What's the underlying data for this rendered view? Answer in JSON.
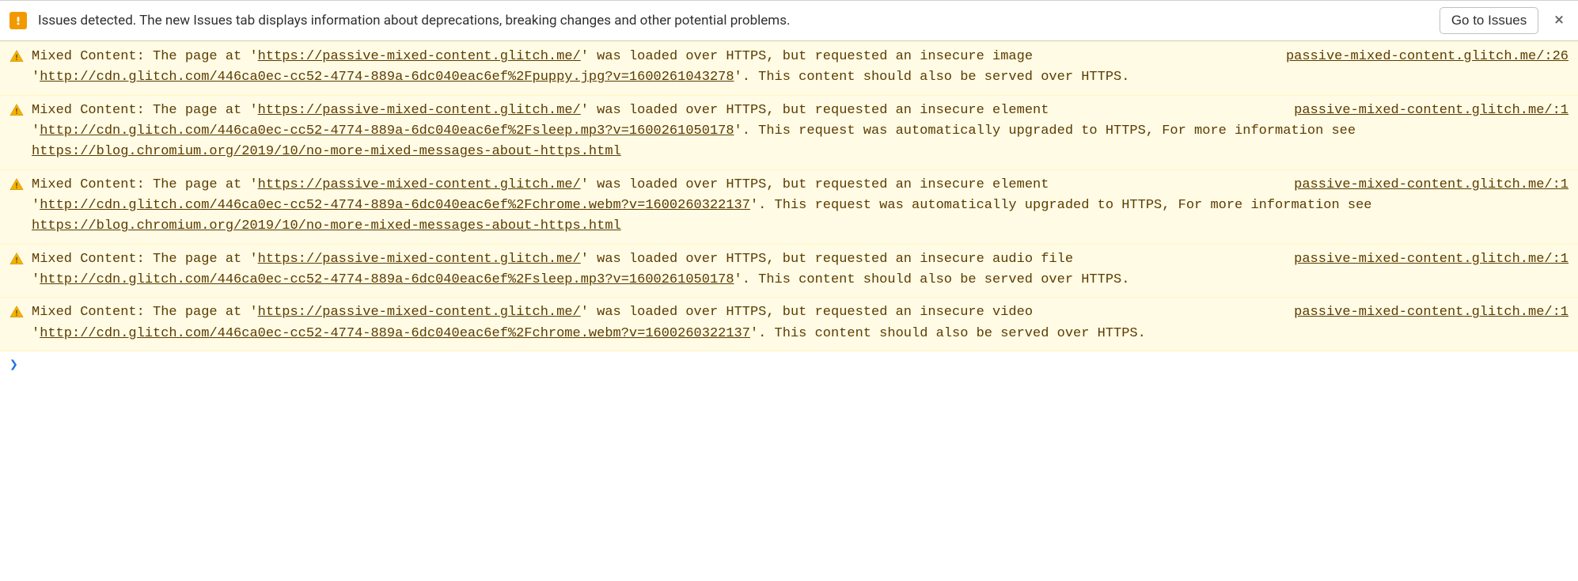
{
  "issues_bar": {
    "text": "Issues detected. The new Issues tab displays information about deprecations, breaking changes and other potential problems.",
    "button_label": "Go to Issues",
    "close_label": "×"
  },
  "messages": [
    {
      "pre1": "Mixed Content: The page at '",
      "page_url": "https://passive-mixed-content.glitch.me/",
      "mid1": "' was loaded over HTTPS, but requested an insecure image '",
      "resource_url": "http://cdn.glitch.com/446ca0ec-cc52-4774-889a-6dc040eac6ef%2Fpuppy.jpg?v=1600261043278",
      "tail": "'. This content should also be served over HTTPS.",
      "info_url": "",
      "source": "passive-mixed-content.glitch.me/:26"
    },
    {
      "pre1": "Mixed Content: The page at '",
      "page_url": "https://passive-mixed-content.glitch.me/",
      "mid1": "' was loaded over HTTPS, but requested an insecure element '",
      "resource_url": "http://cdn.glitch.com/446ca0ec-cc52-4774-889a-6dc040eac6ef%2Fsleep.mp3?v=1600261050178",
      "tail": "'. This request was automatically upgraded to HTTPS, For more information see ",
      "info_url": "https://blog.chromium.org/2019/10/no-more-mixed-messages-about-https.html",
      "source": "passive-mixed-content.glitch.me/:1"
    },
    {
      "pre1": "Mixed Content: The page at '",
      "page_url": "https://passive-mixed-content.glitch.me/",
      "mid1": "' was loaded over HTTPS, but requested an insecure element '",
      "resource_url": "http://cdn.glitch.com/446ca0ec-cc52-4774-889a-6dc040eac6ef%2Fchrome.webm?v=1600260322137",
      "tail": "'. This request was automatically upgraded to HTTPS, For more information see ",
      "info_url": "https://blog.chromium.org/2019/10/no-more-mixed-messages-about-https.html",
      "source": "passive-mixed-content.glitch.me/:1"
    },
    {
      "pre1": "Mixed Content: The page at '",
      "page_url": "https://passive-mixed-content.glitch.me/",
      "mid1": "' was loaded over HTTPS, but requested an insecure audio file '",
      "resource_url": "http://cdn.glitch.com/446ca0ec-cc52-4774-889a-6dc040eac6ef%2Fsleep.mp3?v=1600261050178",
      "tail": "'. This content should also be served over HTTPS.",
      "info_url": "",
      "source": "passive-mixed-content.glitch.me/:1"
    },
    {
      "pre1": "Mixed Content: The page at '",
      "page_url": "https://passive-mixed-content.glitch.me/",
      "mid1": "' was loaded over HTTPS, but requested an insecure video '",
      "resource_url": "http://cdn.glitch.com/446ca0ec-cc52-4774-889a-6dc040eac6ef%2Fchrome.webm?v=1600260322137",
      "tail": "'. This content should also be served over HTTPS.",
      "info_url": "",
      "source": "passive-mixed-content.glitch.me/:1"
    }
  ],
  "prompt": "❯"
}
